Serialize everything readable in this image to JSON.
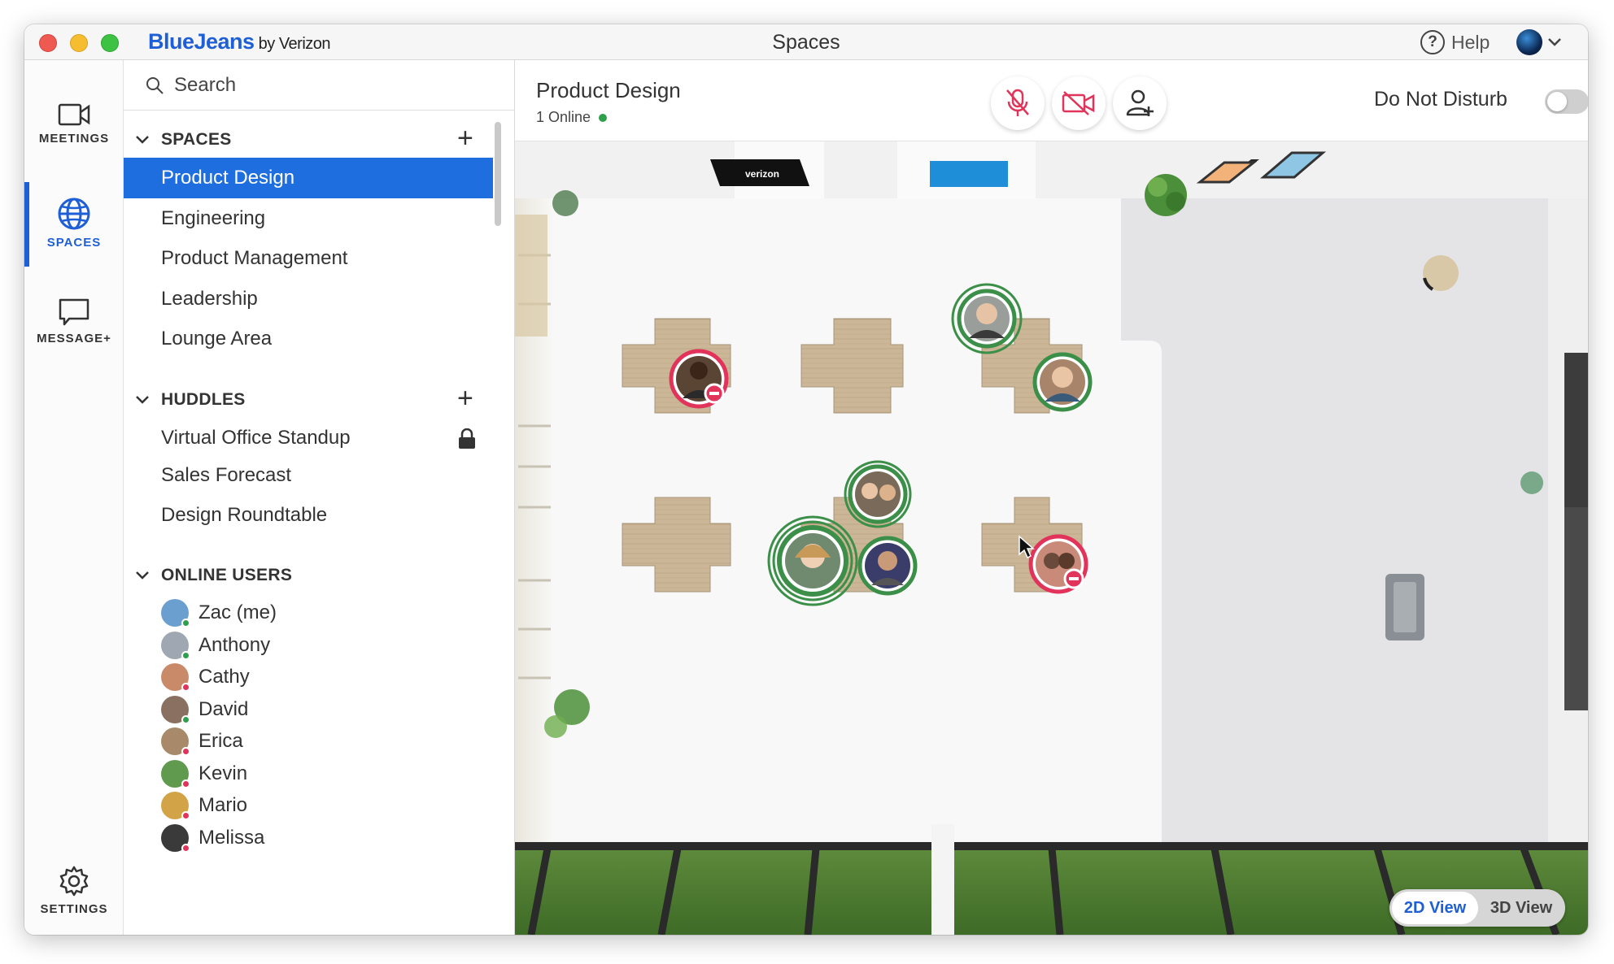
{
  "titlebar": {
    "brand": "BlueJeans",
    "brand_suffix": " by Verizon",
    "window_title": "Spaces",
    "help_label": "Help"
  },
  "rail": {
    "meetings": "MEETINGS",
    "spaces": "SPACES",
    "message": "MESSAGE+",
    "settings": "SETTINGS"
  },
  "search": {
    "placeholder": "Search"
  },
  "spaces": {
    "title": "SPACES",
    "items": [
      "Product Design",
      "Engineering",
      "Product Management",
      "Leadership",
      "Lounge Area"
    ],
    "selected": "Product Design"
  },
  "huddles": {
    "title": "HUDDLES",
    "items": [
      "Virtual Office Standup",
      "Sales Forecast",
      "Design Roundtable"
    ]
  },
  "online_users": {
    "title": "ONLINE USERS",
    "users": [
      {
        "name": "Zac (me)",
        "status_color": "#2e9f4a"
      },
      {
        "name": "Anthony",
        "status_color": "#2e9f4a"
      },
      {
        "name": "Cathy",
        "status_color": "#e2335a"
      },
      {
        "name": "David",
        "status_color": "#2e9f4a"
      },
      {
        "name": "Erica",
        "status_color": "#e2335a"
      },
      {
        "name": "Kevin",
        "status_color": "#e2335a"
      },
      {
        "name": "Mario",
        "status_color": "#e2335a"
      },
      {
        "name": "Melissa",
        "status_color": "#e2335a"
      }
    ]
  },
  "room": {
    "name": "Product Design",
    "online": "1 Online",
    "dnd_label": "Do Not Disturb",
    "dnd_on": false,
    "view_2d": "2D View",
    "view_3d": "3D View",
    "active_view": "2D View"
  },
  "floor_signs": {
    "verizon": "verizon"
  },
  "colors": {
    "accent": "#1f5fd6",
    "online": "#2e9f4a",
    "busy": "#e2335a"
  }
}
